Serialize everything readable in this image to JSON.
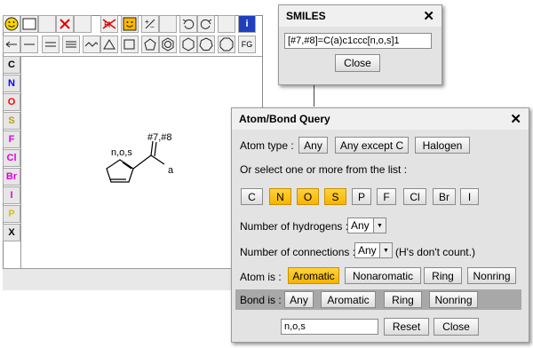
{
  "toolbar": {
    "fg_label": "FG",
    "info_label": "i"
  },
  "atoms": [
    {
      "label": "C",
      "color": "#000000"
    },
    {
      "label": "N",
      "color": "#0000ff"
    },
    {
      "label": "O",
      "color": "#ff0000"
    },
    {
      "label": "S",
      "color": "#b8a000"
    },
    {
      "label": "F",
      "color": "#e000e0"
    },
    {
      "label": "Cl",
      "color": "#e000e0"
    },
    {
      "label": "Br",
      "color": "#e000e0"
    },
    {
      "label": "I",
      "color": "#e000e0"
    },
    {
      "label": "P",
      "color": "#e0c000"
    },
    {
      "label": "X",
      "color": "#000000"
    }
  ],
  "molecule": {
    "ring_label": "n,o,s",
    "query_label": "#7,#8",
    "sub_label": "a"
  },
  "smiles": {
    "title": "SMILES",
    "close_x": "✕",
    "value": "[#7,#8]=C(a)c1ccc[n,o,s]1",
    "close_label": "Close"
  },
  "query": {
    "title": "Atom/Bond Query",
    "close_x": "✕",
    "atom_type_label": "Atom type :",
    "atom_type_buttons": [
      "Any",
      "Any except C",
      "Halogen"
    ],
    "select_text": "Or select one or more from the list :",
    "elements": [
      {
        "label": "C",
        "selected": false
      },
      {
        "label": "N",
        "selected": true
      },
      {
        "label": "O",
        "selected": true
      },
      {
        "label": "S",
        "selected": true
      },
      {
        "label": "P",
        "selected": false
      },
      {
        "label": "F",
        "selected": false
      },
      {
        "label": "Cl",
        "selected": false
      },
      {
        "label": "Br",
        "selected": false
      },
      {
        "label": "I",
        "selected": false
      }
    ],
    "hydrogens_label": "Number of hydrogens :",
    "hydrogens_value": "Any",
    "connections_label": "Number of connections :",
    "connections_value": "Any",
    "connections_note": "(H's don't count.)",
    "atom_is_label": "Atom is :",
    "atom_is_buttons": [
      {
        "label": "Aromatic",
        "selected": true
      },
      {
        "label": "Nonaromatic",
        "selected": false
      },
      {
        "label": "Ring",
        "selected": false
      },
      {
        "label": "Nonring",
        "selected": false
      }
    ],
    "bond_is_label": "Bond is :",
    "bond_is_buttons": [
      "Any",
      "Aromatic",
      "Ring",
      "Nonring"
    ],
    "result_value": "n,o,s",
    "reset_label": "Reset",
    "close_label": "Close"
  },
  "colors": {
    "selected": "#f5b400",
    "bond_row_bg": "#a8a8a8"
  }
}
